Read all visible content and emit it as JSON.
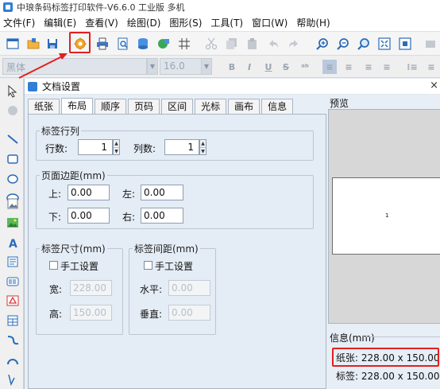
{
  "app": {
    "title": "中琅条码标签打印软件-V6.6.0 工业版 多机"
  },
  "menu": [
    "文件(F)",
    "编辑(E)",
    "查看(V)",
    "绘图(D)",
    "图形(S)",
    "工具(T)",
    "窗口(W)",
    "帮助(H)"
  ],
  "toolbar": {
    "icons": [
      "new-document-icon",
      "open-folder-icon",
      "save-icon",
      "document-settings-icon",
      "print-icon",
      "print-preview-icon",
      "database-icon",
      "data-source-icon",
      "grid-icon",
      "cut-icon",
      "copy-icon",
      "paste-icon",
      "undo-icon",
      "redo-icon",
      "zoom-in-icon",
      "zoom-out-icon",
      "zoom-fit-icon",
      "zoom-actual-icon",
      "fullscreen-icon",
      "more-icon"
    ],
    "highlighted": "document-settings-icon",
    "highlight_color": "#e02020"
  },
  "font_toolbar": {
    "font_name": "黑体",
    "font_size": "16.0",
    "buttons": [
      "B",
      "I",
      "U",
      "S"
    ]
  },
  "dialog": {
    "title": "文档设置",
    "close_label": "×",
    "tabs": [
      {
        "label": "纸张",
        "active": false
      },
      {
        "label": "布局",
        "active": true
      },
      {
        "label": "顺序",
        "active": false
      },
      {
        "label": "页码",
        "active": false
      },
      {
        "label": "区间",
        "active": false
      },
      {
        "label": "光标",
        "active": false
      },
      {
        "label": "画布",
        "active": false
      },
      {
        "label": "信息",
        "active": false
      }
    ],
    "rows_cols": {
      "legend": "标签行列",
      "rows_label": "行数:",
      "rows_value": "1",
      "cols_label": "列数:",
      "cols_value": "1"
    },
    "margins": {
      "legend": "页面边距(mm)",
      "top_label": "上:",
      "top_value": "0.00",
      "left_label": "左:",
      "left_value": "0.00",
      "bottom_label": "下:",
      "bottom_value": "0.00",
      "right_label": "右:",
      "right_value": "0.00"
    },
    "label_size": {
      "legend": "标签尺寸(mm)",
      "manual_label": "手工设置",
      "width_label": "宽:",
      "width_value": "228.00",
      "height_label": "高:",
      "height_value": "150.00"
    },
    "label_gap": {
      "legend": "标签间距(mm)",
      "manual_label": "手工设置",
      "horizontal_label": "水平:",
      "horizontal_value": "0.00",
      "vertical_label": "垂直:",
      "vertical_value": "0.00"
    },
    "preview": {
      "label": "预览",
      "page_number": "1"
    },
    "info": {
      "legend": "信息(mm)",
      "paper_text": "纸张: 228.00 x 150.00",
      "label_text": "标签: 228.00 x 150.00"
    }
  }
}
